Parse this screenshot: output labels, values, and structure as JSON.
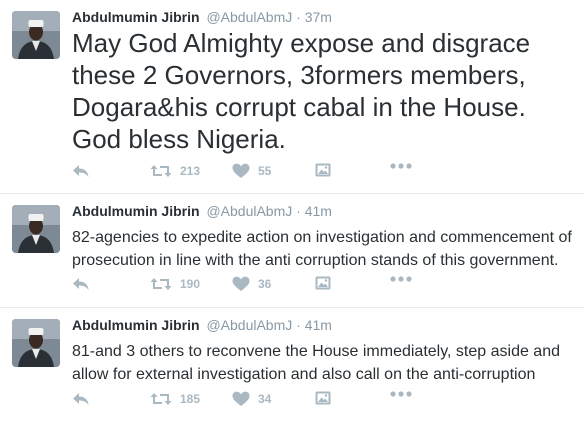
{
  "tweets": [
    {
      "fullname": "Abdulmumin Jibrin",
      "username": "@AbdulAbmJ",
      "separator": "·",
      "time": "37m",
      "text": "May God Almighty expose and disgrace these 2 Governors, 3formers members, Dogara&his corrupt cabal in the House. God bless Nigeria.",
      "retweets": "213",
      "likes": "55"
    },
    {
      "fullname": "Abdulmumin Jibrin",
      "username": "@AbdulAbmJ",
      "separator": "·",
      "time": "41m",
      "text": "82-agencies to expedite action on investigation and commencement of prosecution in line with the anti corruption stands of this government.",
      "retweets": "190",
      "likes": "36"
    },
    {
      "fullname": "Abdulmumin Jibrin",
      "username": "@AbdulAbmJ",
      "separator": "·",
      "time": "41m",
      "text": "81-and 3 others to reconvene the House immediately, step aside and allow for external investigation and also call on the anti-corruption",
      "retweets": "185",
      "likes": "34"
    }
  ],
  "icons": {
    "reply": "reply-icon",
    "retweet": "retweet-icon",
    "like": "heart-icon",
    "image": "image-icon",
    "more": "more-icon"
  },
  "colors": {
    "text": "#292f33",
    "muted": "#8899a6",
    "action_icon": "#aab8c2",
    "divider": "#e6ecf0"
  }
}
